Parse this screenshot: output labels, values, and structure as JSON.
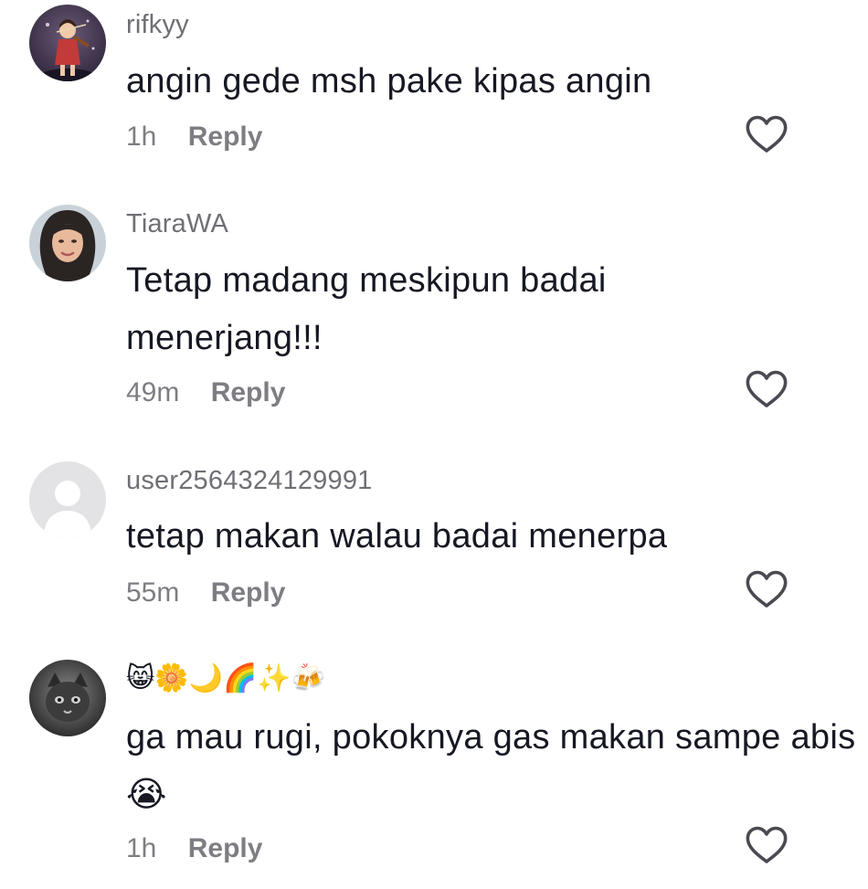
{
  "comments": [
    {
      "username": "rifkyy",
      "text": "angin gede msh pake kipas angin",
      "time": "1h",
      "reply_label": "Reply",
      "avatar": "avatar-violinist"
    },
    {
      "username": "TiaraWA",
      "text": "Tetap madang meskipun badai menerjang!!!",
      "time": "49m",
      "reply_label": "Reply",
      "avatar": "avatar-hijab-woman"
    },
    {
      "username": "user2564324129991",
      "text": "tetap makan walau badai menerpa",
      "time": "55m",
      "reply_label": "Reply",
      "avatar": "avatar-default-user"
    },
    {
      "username": "😸🌼🌙🌈✨🍻",
      "text": "ga mau rugi, pokoknya gas makan sampe abis😭",
      "time": "1h",
      "reply_label": "Reply",
      "avatar": "avatar-dark-cat"
    }
  ],
  "icons": {
    "like": "heart-outline-icon"
  },
  "colors": {
    "text": "#161823",
    "username": "#6f6f75",
    "meta": "#7d7d83",
    "heart_stroke": "#4a4a52",
    "default_avatar_bg": "#e3e3e5"
  }
}
